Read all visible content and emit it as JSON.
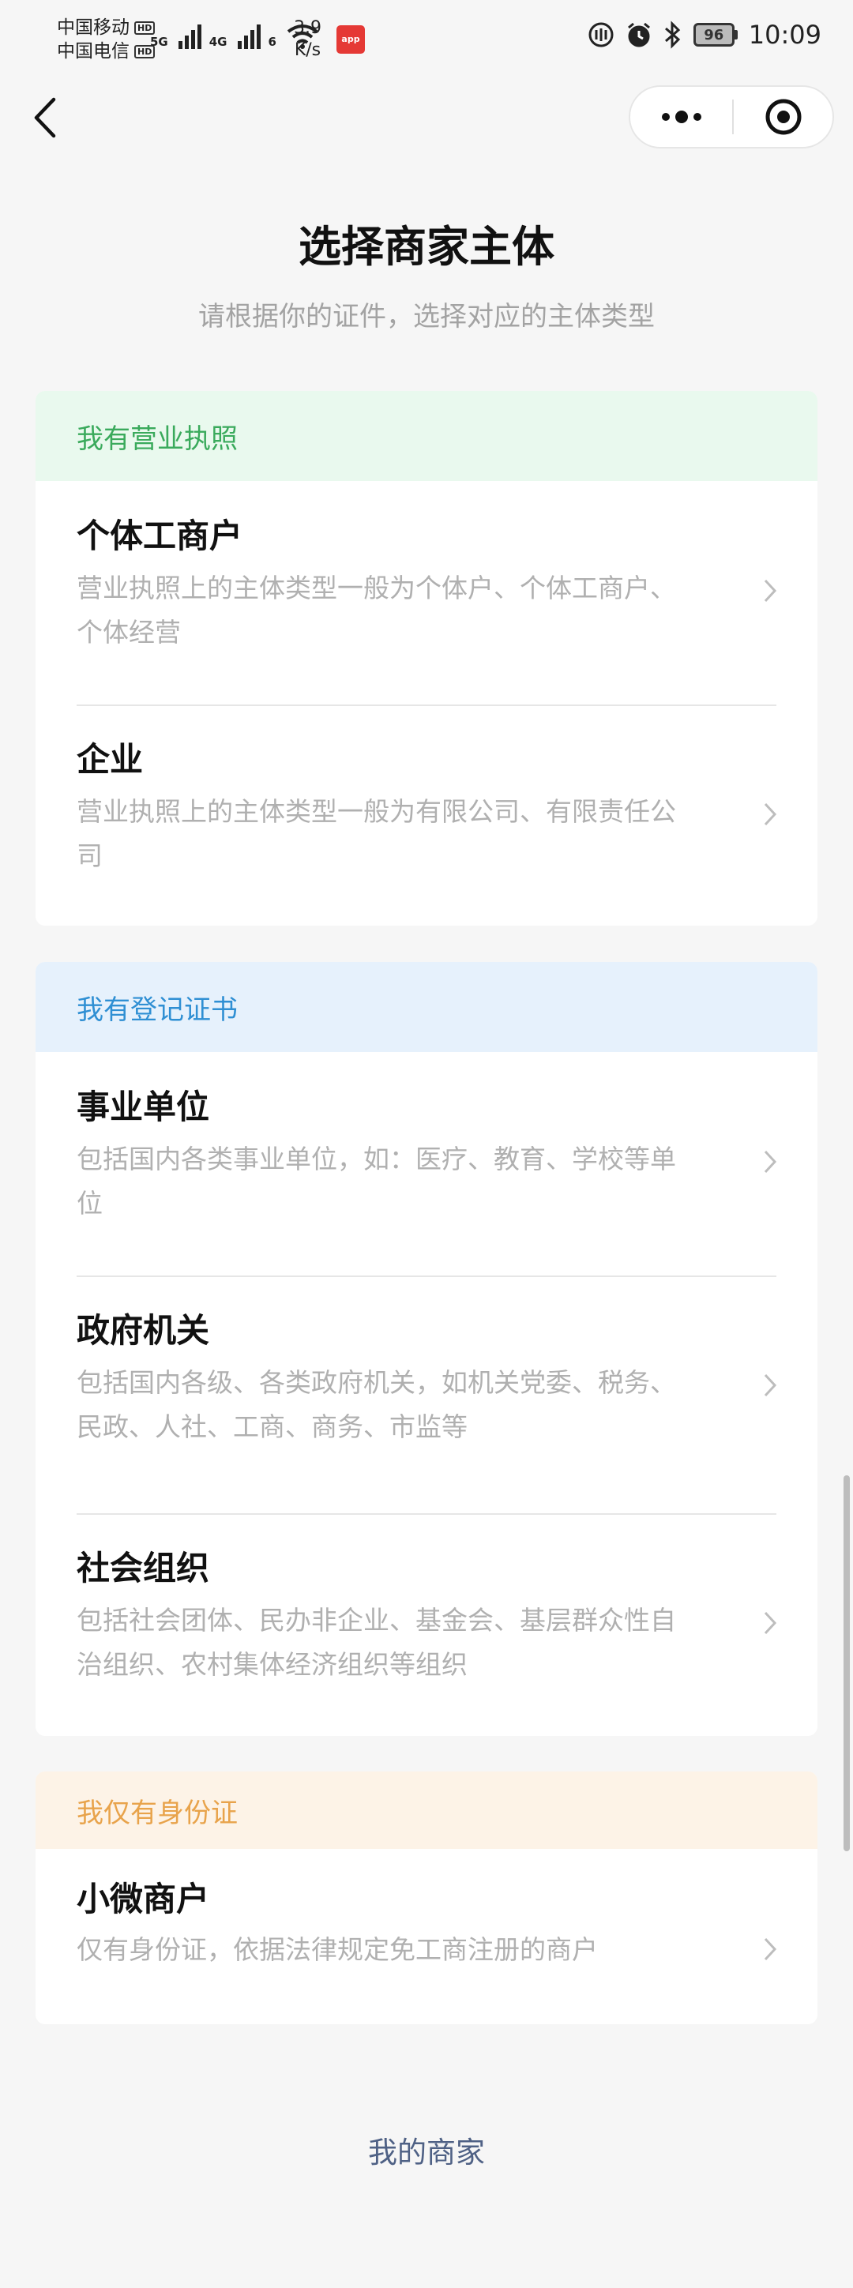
{
  "status_bar": {
    "carrier1": "中国移动",
    "carrier2": "中国电信",
    "hd_badge": "HD",
    "signal1_label": "5G",
    "signal2_label": "4G",
    "wifi_label": "6",
    "net_speed_value": "3.9",
    "net_speed_unit": "K/s",
    "battery_level": "96",
    "time": "10:09"
  },
  "header": {
    "title": "选择商家主体",
    "subtitle": "请根据你的证件，选择对应的主体类型"
  },
  "sections": [
    {
      "header": "我有营业执照",
      "header_bg": "#e9f9ee",
      "header_color": "#3aaa5c",
      "items": [
        {
          "title": "个体工商户",
          "desc1": "营业执照上的主体类型一般为个体户、个体工商户、",
          "desc2": "个体经营"
        },
        {
          "title": "企业",
          "desc1": "营业执照上的主体类型一般为有限公司、有限责任公",
          "desc2": "司"
        }
      ]
    },
    {
      "header": "我有登记证书",
      "header_bg": "#e6f1fc",
      "header_color": "#2f8fd3",
      "items": [
        {
          "title": "事业单位",
          "desc1": "包括国内各类事业单位，如：医疗、教育、学校等单",
          "desc2": "位"
        },
        {
          "title": "政府机关",
          "desc1": "包括国内各级、各类政府机关，如机关党委、税务、",
          "desc2": "民政、人社、工商、商务、市监等"
        },
        {
          "title": "社会组织",
          "desc1": "包括社会团体、民办非企业、基金会、基层群众性自",
          "desc2": "治组织、农村集体经济组织等组织"
        }
      ]
    },
    {
      "header": "我仅有身份证",
      "header_bg": "#fdf3e7",
      "header_color": "#e8a34b",
      "items": [
        {
          "title": "小微商户",
          "desc1": "仅有身份证，依据法律规定免工商注册的商户"
        }
      ]
    }
  ],
  "footer": {
    "link": "我的商家"
  }
}
